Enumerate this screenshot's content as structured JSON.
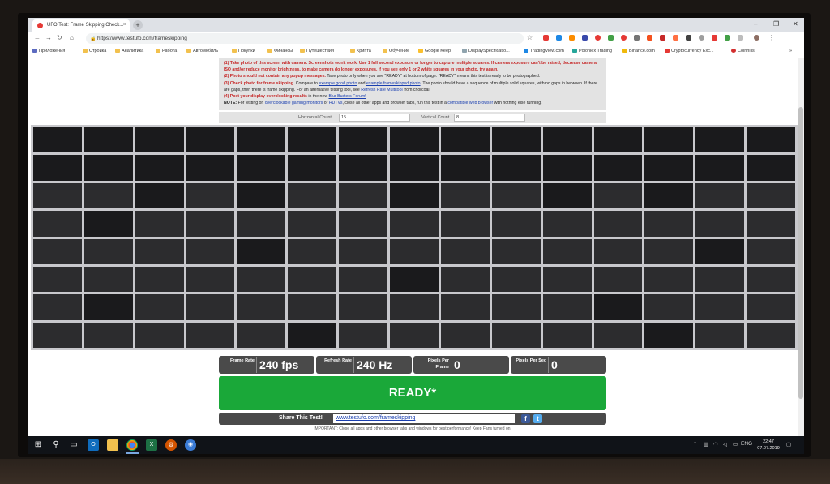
{
  "browser": {
    "tab_title": "UFO Test: Frame Skipping Check...",
    "tab_close": "×",
    "new_tab": "+",
    "url": "https://www.testufo.com/frameskipping",
    "bookmarks": [
      "Приложения",
      "Стройка",
      "Аналитика",
      "Работа",
      "Автомобиль",
      "Покупки",
      "Финансы",
      "Путешествия",
      "Крипта",
      "Обучение",
      "Google Keep",
      "DisplaySpecificatio...",
      "TradingView.com",
      "Poloniex Trading",
      "Binance.com",
      "Cryptocurrency Exc...",
      "Coinhills"
    ],
    "bookmarks_more": "»"
  },
  "instructions": {
    "line1": "(1) Take photo of this screen with camera. Screenshots won't work. Use 1 full second exposure or longer to capture multiple squares. If camera exposure can't be raised, decrease camera ISO and/or reduce monitor brightness, to make camera do longer exposures. If you see only 1 or 2 white squares in your photo, try again.",
    "line2_title": "(2) Photo should not contain any popup messages.",
    "line2_body": "Take photo only when you see \"READY\" at bottom of page. \"READY\" means this test is ready to be photographed.",
    "line3_title": "(3) Check photo for frame skipping.",
    "line3_body_a": "Compare to",
    "line3_link_a": "example good photo",
    "line3_body_b": "and",
    "line3_link_b": "example frameskipped photo",
    "line3_body_c": ". The photo should have a sequence of multiple solid squares, with no gaps in between. If there are gaps, then there is frame skipping. For an alternative testing tool, see",
    "line3_link_c": "Refresh Rate Multitool",
    "line3_body_d": "from chorcoal.",
    "line4_title": "(4) Post your display overclocking results",
    "line4_body": "in the new",
    "line4_link": "Blur Busters Forum!",
    "note_label": "NOTE:",
    "note_body_a": "For testing on",
    "note_link_a": "overclockable gaming monitors",
    "note_body_b": "or",
    "note_link_b": "HDTVs",
    "note_body_c": ", close all other apps and browser tabs, run this test in a",
    "note_link_c": "compatible web browser",
    "note_body_d": "with nothing else running."
  },
  "counts": {
    "horizontal_label": "Horizontal Count",
    "horizontal_value": "15",
    "vertical_label": "Vertical Count",
    "vertical_value": "8"
  },
  "grid": {
    "columns": 15,
    "rows": 8,
    "dark_cells": [
      [
        0,
        0
      ],
      [
        0,
        1
      ],
      [
        0,
        2
      ],
      [
        0,
        3
      ],
      [
        0,
        4
      ],
      [
        0,
        5
      ],
      [
        0,
        6
      ],
      [
        0,
        7
      ],
      [
        0,
        8
      ],
      [
        0,
        9
      ],
      [
        0,
        10
      ],
      [
        0,
        11
      ],
      [
        0,
        12
      ],
      [
        0,
        13
      ],
      [
        0,
        14
      ],
      [
        1,
        0
      ],
      [
        1,
        1
      ],
      [
        1,
        2
      ],
      [
        1,
        3
      ],
      [
        1,
        4
      ],
      [
        1,
        5
      ],
      [
        1,
        6
      ],
      [
        1,
        7
      ],
      [
        1,
        8
      ],
      [
        1,
        9
      ],
      [
        1,
        10
      ],
      [
        1,
        11
      ],
      [
        1,
        12
      ],
      [
        1,
        13
      ],
      [
        1,
        14
      ],
      [
        2,
        2
      ],
      [
        2,
        4
      ],
      [
        2,
        7
      ],
      [
        2,
        10
      ],
      [
        2,
        12
      ],
      [
        3,
        1
      ],
      [
        4,
        4
      ],
      [
        4,
        13
      ],
      [
        5,
        7
      ],
      [
        6,
        1
      ],
      [
        6,
        11
      ],
      [
        7,
        5
      ],
      [
        7,
        12
      ]
    ],
    "dark_color": "#1a1a1c",
    "mid_color": "#2c2c2e",
    "line_color": "#c8c8cc"
  },
  "stats": [
    {
      "label": "Frame Rate",
      "value": "240 fps"
    },
    {
      "label": "Refresh Rate",
      "value": "240 Hz"
    },
    {
      "label": "Pixels Per Frame",
      "value": "0"
    },
    {
      "label": "Pixels Per Sec",
      "value": "0"
    }
  ],
  "ready_label": "READY*",
  "share": {
    "label": "Share This Test!",
    "url": "www.testufo.com/frameskipping",
    "facebook": "f",
    "twitter": "t"
  },
  "important_text": "IMPORTANT: Close all apps and other browser tabs and windows for best performance! Keep Fans turned on.",
  "taskbar": {
    "lang": "ENG",
    "time": "22:47",
    "date": "07.07.2019"
  },
  "colors": {
    "ready_green": "#1aa839",
    "stat_bar": "#4a4a4a",
    "instruction_red": "#c62828"
  }
}
